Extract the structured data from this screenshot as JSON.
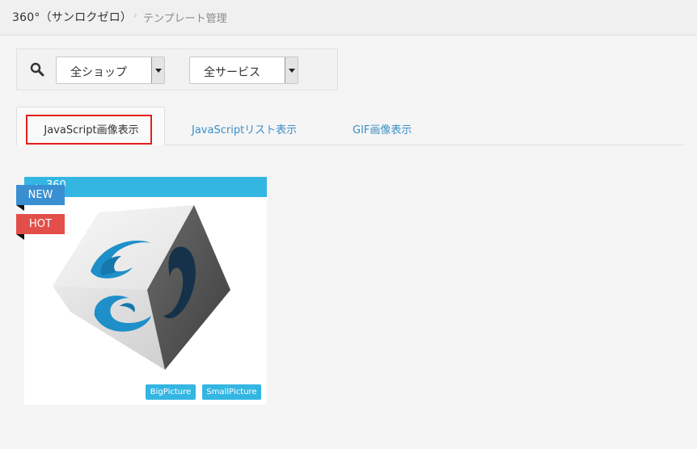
{
  "breadcrumb": {
    "root": "360°（サンロクゼロ）",
    "separator": "›",
    "current": "テンプレート管理"
  },
  "filters": {
    "search_icon": "search-icon",
    "shop_select": "全ショップ",
    "service_select": "全サービス"
  },
  "tabs": [
    {
      "label": "JavaScript画像表示",
      "active": true
    },
    {
      "label": "JavaScriptリスト表示",
      "active": false
    },
    {
      "label": "GIF画像表示",
      "active": false
    }
  ],
  "card": {
    "header_icon": "tag-icon",
    "header_title": "360",
    "ribbons": [
      "NEW",
      "HOT"
    ],
    "buttons": {
      "big": "BigPicture",
      "small": "SmallPicture"
    }
  },
  "colors": {
    "accent": "#34b6e3",
    "new_ribbon": "#3a8fd2",
    "hot_ribbon": "#e24f4a",
    "tab_highlight": "#e41f1f",
    "tab_link": "#3a8fc7"
  }
}
